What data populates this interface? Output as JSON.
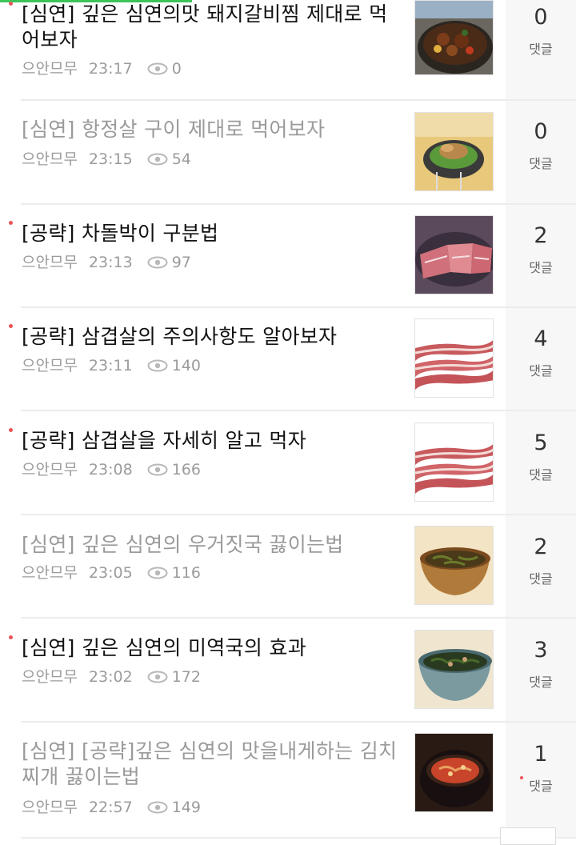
{
  "posts": [
    {
      "title": "[심연] 깊은 심연의맛 돼지갈비찜 제대로 먹어보자",
      "author": "으안므무",
      "time": "23:17",
      "views": "0",
      "comments": "0",
      "comment_label": "댓글",
      "read": false,
      "thumb_icon": "braised-pork-ribs-photo"
    },
    {
      "title": "[심연] 항정살 구이 제대로 먹어보자",
      "author": "으안므무",
      "time": "23:15",
      "views": "54",
      "comments": "0",
      "comment_label": "댓글",
      "read": true,
      "thumb_icon": "grilled-pork-jowl-photo"
    },
    {
      "title": "[공략] 차돌박이 구분법",
      "author": "으안므무",
      "time": "23:13",
      "views": "97",
      "comments": "2",
      "comment_label": "댓글",
      "read": false,
      "thumb_icon": "beef-brisket-photo"
    },
    {
      "title": "[공략] 삼겹살의 주의사항도 알아보자",
      "author": "으안므무",
      "time": "23:11",
      "views": "140",
      "comments": "4",
      "comment_label": "댓글",
      "read": false,
      "thumb_icon": "pork-belly-photo"
    },
    {
      "title": "[공략] 삼겹살을 자세히 알고 먹자",
      "author": "으안므무",
      "time": "23:08",
      "views": "166",
      "comments": "5",
      "comment_label": "댓글",
      "read": false,
      "thumb_icon": "pork-belly-photo"
    },
    {
      "title": "[심연] 깊은 심연의 우거짓국 끓이는법",
      "author": "으안므무",
      "time": "23:05",
      "views": "116",
      "comments": "2",
      "comment_label": "댓글",
      "read": true,
      "thumb_icon": "cabbage-soup-photo"
    },
    {
      "title": "[심연] 깊은 심연의 미역국의 효과",
      "author": "으안므무",
      "time": "23:02",
      "views": "172",
      "comments": "3",
      "comment_label": "댓글",
      "read": false,
      "thumb_icon": "seaweed-soup-photo"
    },
    {
      "title": "[심연] [공략]깊은 심연의 맛을내게하는 김치찌개 끓이는법",
      "author": "으안므무",
      "time": "22:57",
      "views": "149",
      "comments": "1",
      "comment_label": "댓글",
      "read": true,
      "thumb_icon": "kimchi-stew-photo"
    }
  ],
  "colors": {
    "accent_green": "#3bc45a",
    "new_dot": "#e9545b",
    "read_title": "#9a9a9a",
    "meta_text": "#9b9b9b"
  },
  "icons": {
    "views": "eye-icon",
    "new_indicator": "red-dot-icon"
  }
}
